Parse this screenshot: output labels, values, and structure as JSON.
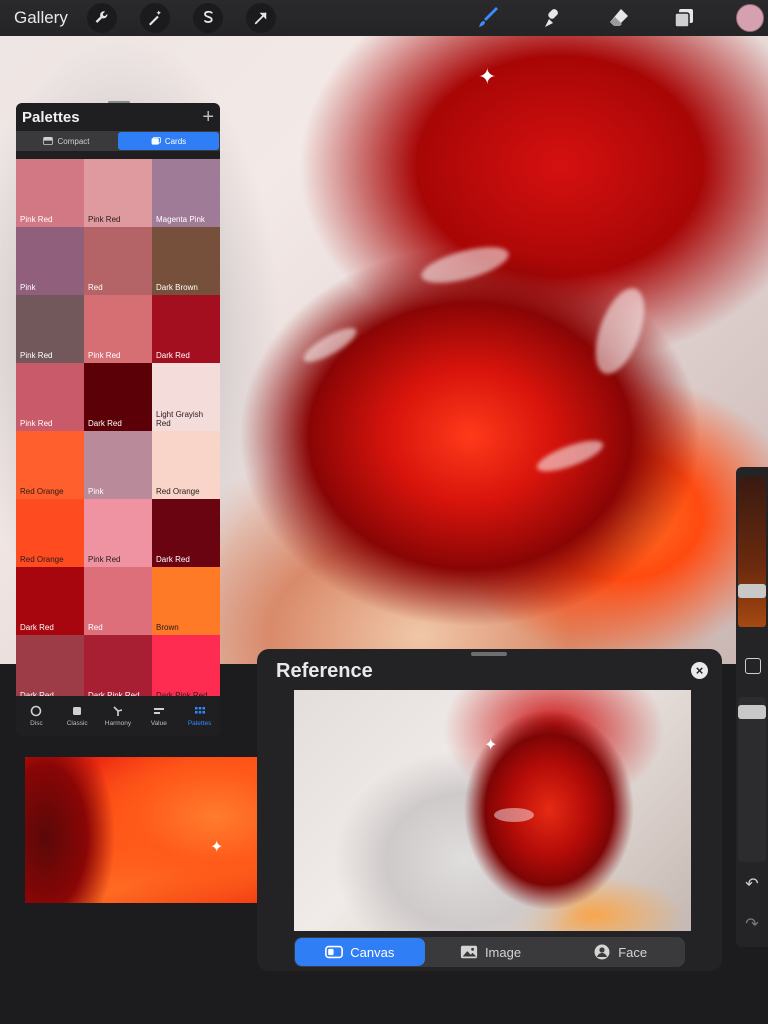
{
  "topbar": {
    "gallery_label": "Gallery",
    "left_tools": [
      "wrench-icon",
      "magic-wand-icon",
      "selection-icon",
      "transform-arrow-icon"
    ],
    "right_tools": [
      "brush-icon",
      "smudge-icon",
      "eraser-icon",
      "layers-icon"
    ],
    "active_color": "#d7a0b0"
  },
  "palettes": {
    "title": "Palettes",
    "add_symbol": "+",
    "view_compact": "Compact",
    "view_cards": "Cards",
    "active_view": "Cards",
    "swatches": [
      {
        "name": "Pink Red",
        "color": "#d27884",
        "text": "#ffffff"
      },
      {
        "name": "Pink Red",
        "color": "#df9aa0",
        "text": "#2a1a1c"
      },
      {
        "name": "Magenta Pink",
        "color": "#a07b98",
        "text": "#ffffff"
      },
      {
        "name": "Pink",
        "color": "#8f5f7c",
        "text": "#ffffff"
      },
      {
        "name": "Red",
        "color": "#b46367",
        "text": "#ffffff"
      },
      {
        "name": "Dark Brown",
        "color": "#76503a",
        "text": "#ffffff"
      },
      {
        "name": "Pink Red",
        "color": "#73585b",
        "text": "#ffffff"
      },
      {
        "name": "Pink Red",
        "color": "#d66f74",
        "text": "#ffffff"
      },
      {
        "name": "Dark Red",
        "color": "#a30f1f",
        "text": "#ffffff"
      },
      {
        "name": "Pink Red",
        "color": "#c95a6a",
        "text": "#ffffff"
      },
      {
        "name": "Dark Red",
        "color": "#5c0007",
        "text": "#ffffff"
      },
      {
        "name": "Light Grayish Red",
        "color": "#f3dcd9",
        "text": "#2a1a1c"
      },
      {
        "name": "Red Orange",
        "color": "#ff5f2c",
        "text": "#2a1a1c"
      },
      {
        "name": "Pink",
        "color": "#b98a9a",
        "text": "#ffffff"
      },
      {
        "name": "Red Orange",
        "color": "#f8d5c8",
        "text": "#2a1a1c"
      },
      {
        "name": "Red Orange",
        "color": "#ff4b20",
        "text": "#2a1a1c"
      },
      {
        "name": "Pink Red",
        "color": "#ef93a3",
        "text": "#2a1a1c"
      },
      {
        "name": "Dark Red",
        "color": "#6b0411",
        "text": "#ffffff"
      },
      {
        "name": "Dark Red",
        "color": "#a7060e",
        "text": "#ffffff"
      },
      {
        "name": "Red",
        "color": "#dc6f7a",
        "text": "#ffffff"
      },
      {
        "name": "Brown",
        "color": "#ff7a26",
        "text": "#2a1a1c"
      },
      {
        "name": "Dark Red",
        "color": "#9d3b47",
        "text": "#ffffff"
      },
      {
        "name": "Dark Pink Red",
        "color": "#a81f33",
        "text": "#ffffff"
      },
      {
        "name": "Dark Pink Red",
        "color": "#ff2c52",
        "text": "#2a1a1c"
      }
    ],
    "tabs": [
      {
        "label": "Disc",
        "icon": "disc-icon"
      },
      {
        "label": "Classic",
        "icon": "classic-square-icon"
      },
      {
        "label": "Harmony",
        "icon": "harmony-icon"
      },
      {
        "label": "Value",
        "icon": "value-sliders-icon"
      },
      {
        "label": "Palettes",
        "icon": "palettes-grid-icon"
      }
    ],
    "active_tab": "Palettes"
  },
  "reference": {
    "title": "Reference",
    "close_symbol": "×",
    "modes": [
      {
        "label": "Canvas",
        "icon": "canvas-toggle-icon"
      },
      {
        "label": "Image",
        "icon": "image-icon"
      },
      {
        "label": "Face",
        "icon": "face-icon"
      }
    ],
    "active_mode": "Canvas"
  },
  "sidebar": {
    "undo_symbol": "↶",
    "redo_symbol": "↷"
  }
}
